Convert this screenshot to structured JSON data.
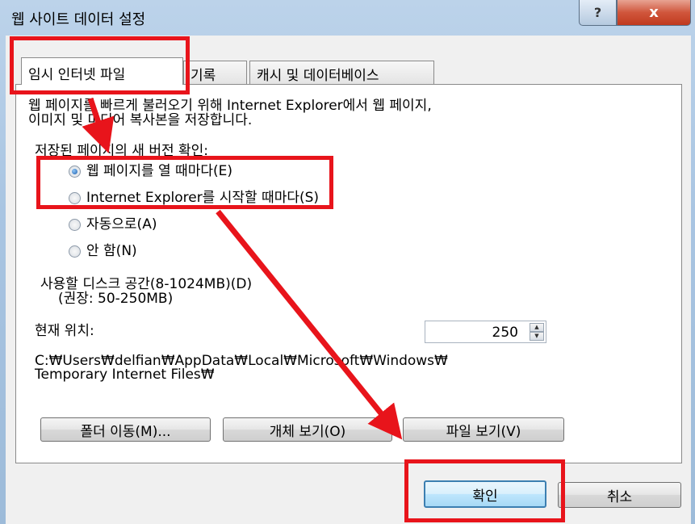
{
  "window": {
    "title": "웹 사이트 데이터 설정",
    "help_glyph": "?",
    "close_glyph": "x"
  },
  "tabs": [
    {
      "label": "임시 인터넷 파일",
      "selected": true
    },
    {
      "label": "기록",
      "selected": false
    },
    {
      "label": "캐시 및 데이터베이스",
      "selected": false
    }
  ],
  "panel": {
    "description_line1": "웹 페이지를 빠르게 불러오기 위해 Internet Explorer에서 웹 페이지,",
    "description_line2": "이미지 및 미디어 복사본을 저장합니다.",
    "check_heading": "저장된 페이지의 새 버전 확인:",
    "radio_options": [
      {
        "label": "웹 페이지를 열 때마다(E)",
        "checked": true
      },
      {
        "label": "Internet Explorer를 시작할 때마다(S)",
        "checked": false
      },
      {
        "label": "자동으로(A)",
        "checked": false
      },
      {
        "label": "안 함(N)",
        "checked": false
      }
    ],
    "disk_space_label": "사용할 디스크 공간(8-1024MB)(D)",
    "disk_space_hint": "(권장: 50-250MB)",
    "disk_space_value": "250",
    "location_label": "현재 위치:",
    "location_path_line1": "C:₩Users₩delfian₩AppData₩Local₩Microsoft₩Windows₩",
    "location_path_line2": "Temporary Internet Files₩",
    "move_folder_button": "폴더 이동(M)...",
    "view_objects_button": "개체 보기(O)",
    "view_files_button": "파일 보기(V)"
  },
  "footer": {
    "ok_button": "확인",
    "cancel_button": "취소"
  },
  "colors": {
    "annotation_red": "#e8141b",
    "default_button_border": "#3c7fb1"
  }
}
